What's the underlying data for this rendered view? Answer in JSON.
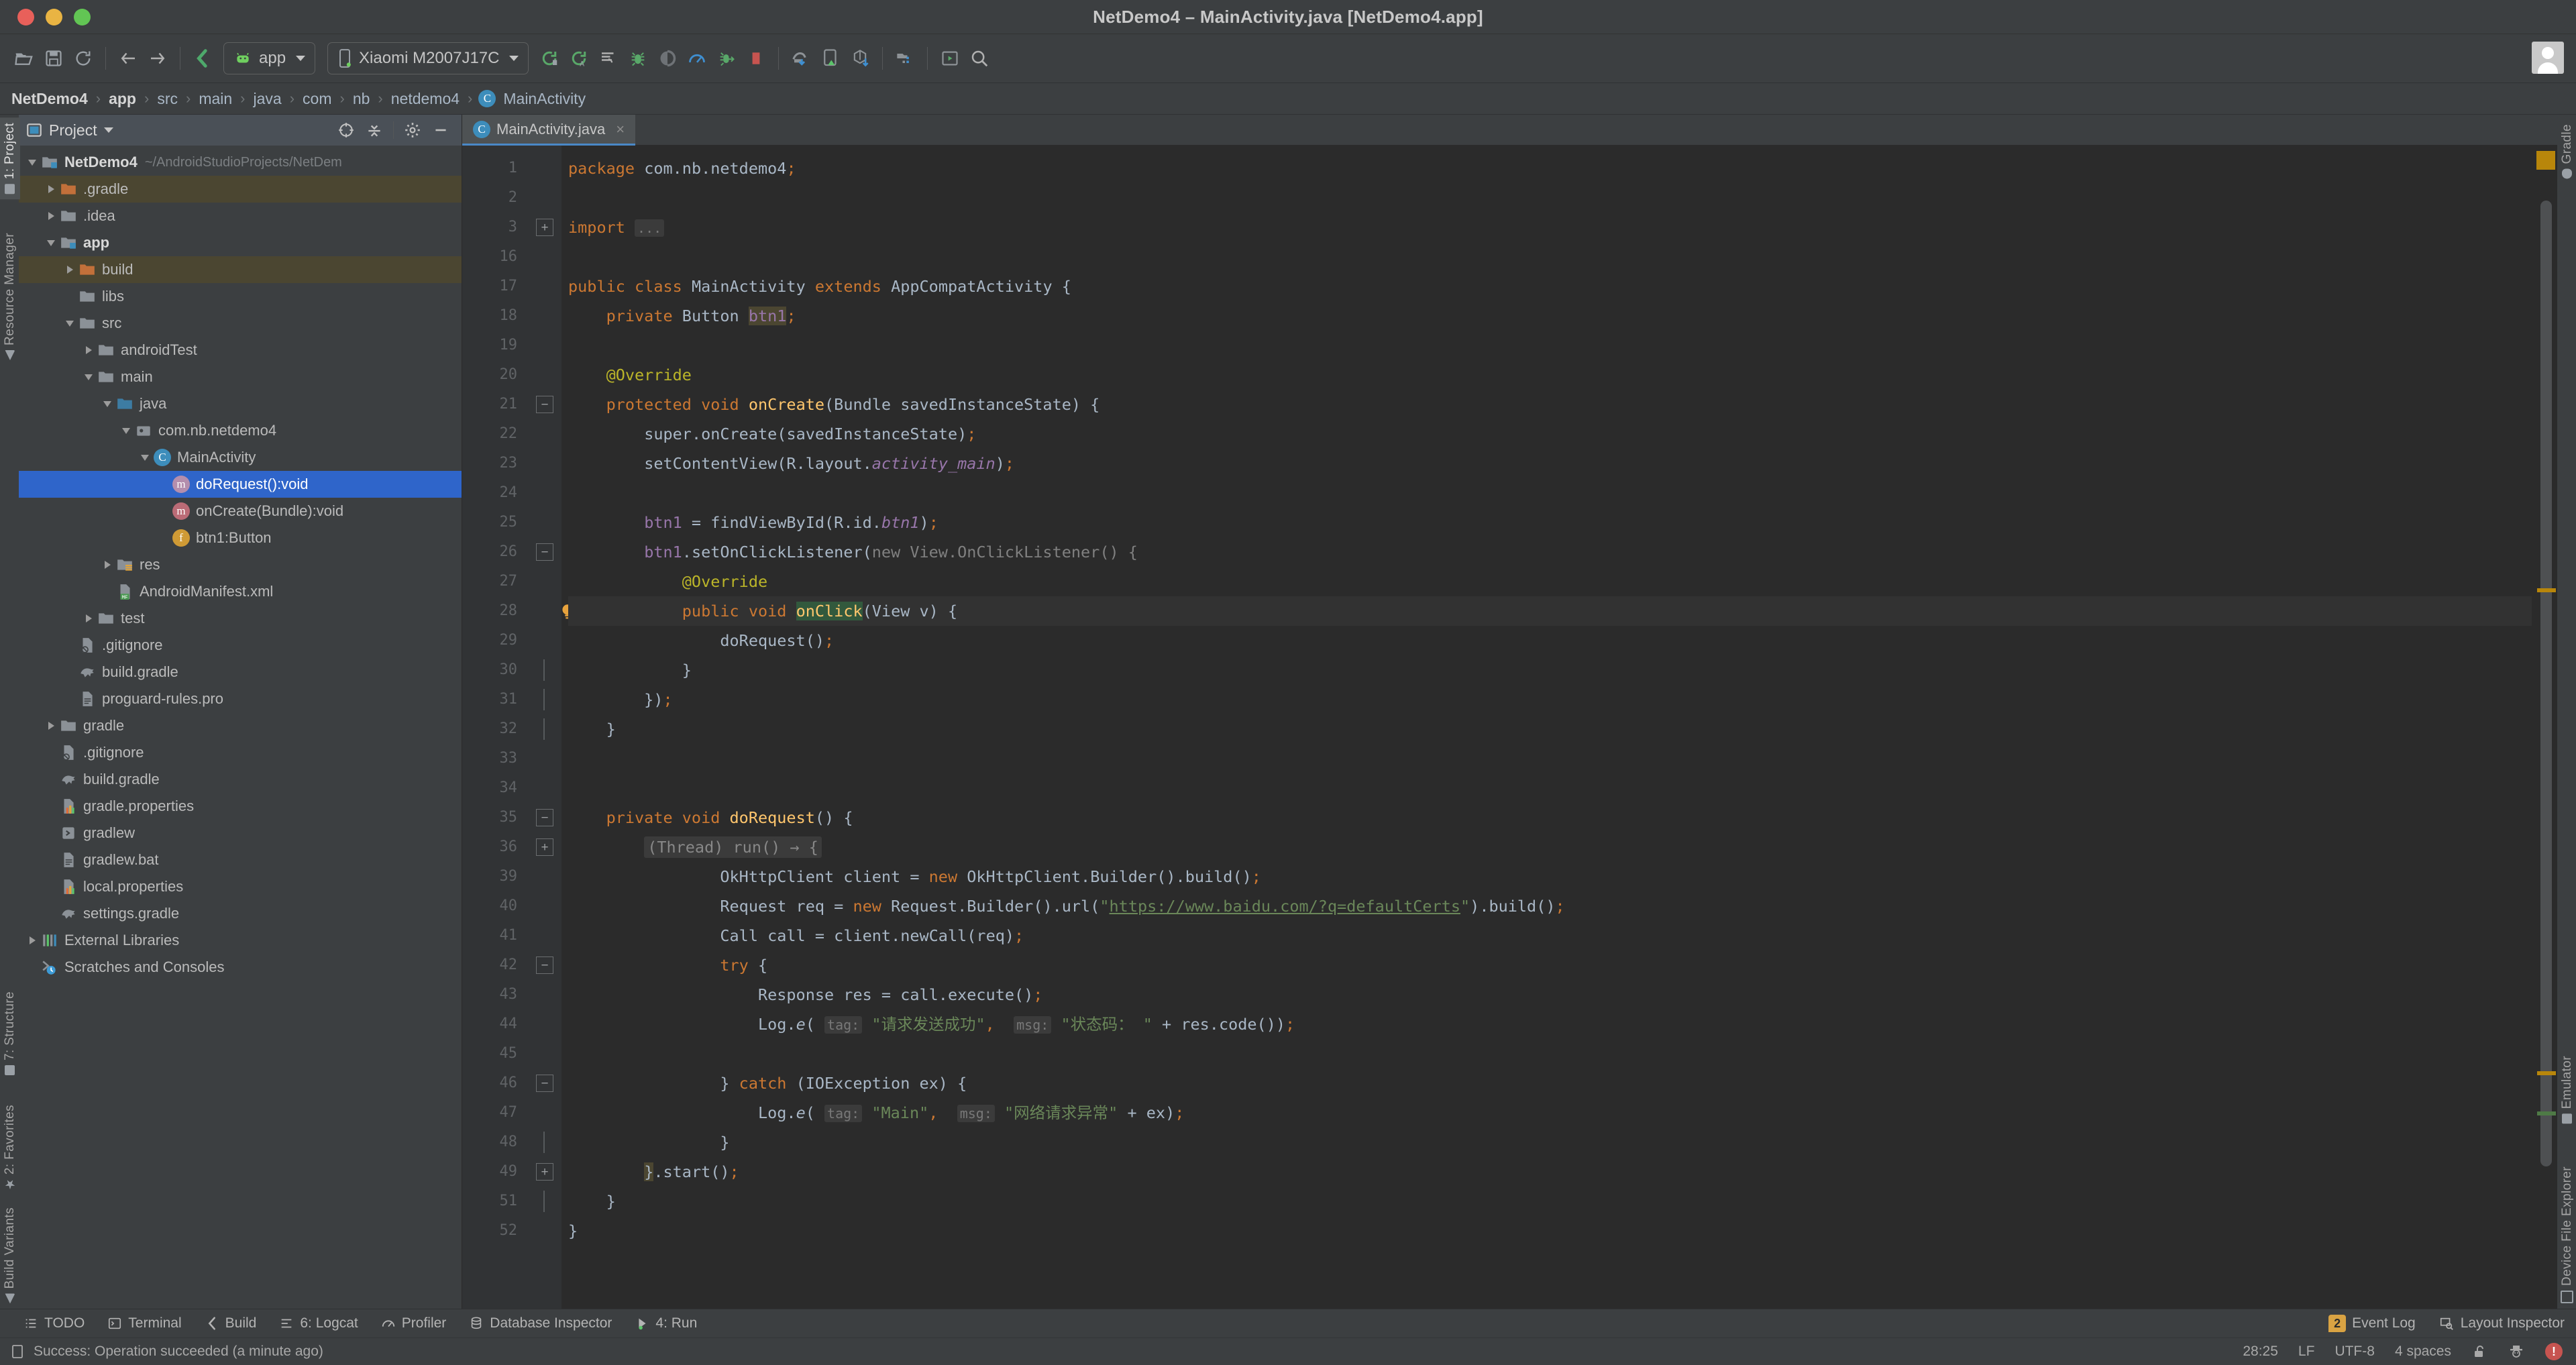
{
  "window": {
    "title": "NetDemo4 – MainActivity.java [NetDemo4.app]",
    "traffic": [
      "close",
      "minimize",
      "zoom"
    ]
  },
  "toolbar": {
    "buttons": [
      {
        "name": "open-folder-icon",
        "tip": "Open"
      },
      {
        "name": "save-all-icon",
        "tip": "Save All"
      },
      {
        "name": "sync-icon",
        "tip": "Sync Project with Gradle Files"
      },
      {
        "name": "back-arrow-icon",
        "tip": "Back"
      },
      {
        "name": "forward-arrow-icon",
        "tip": "Forward"
      },
      {
        "name": "avd-manager-icon",
        "tip": "AVD Manager"
      }
    ],
    "module_selector": {
      "label": "app",
      "icon": "android-icon"
    },
    "device_selector": {
      "label": "Xiaomi M2007J17C",
      "icon": "device-icon"
    },
    "run_buttons": [
      {
        "name": "run-icon",
        "tip": "Run 'app'"
      },
      {
        "name": "apply-changes-icon",
        "tip": "Apply Changes"
      },
      {
        "name": "apply-code-changes-icon",
        "tip": "Apply Code Changes"
      },
      {
        "name": "debug-icon",
        "tip": "Debug 'app'"
      },
      {
        "name": "run-coverage-icon",
        "tip": "Run with Coverage"
      },
      {
        "name": "profiler-icon",
        "tip": "Profile 'app'"
      },
      {
        "name": "attach-debugger-icon",
        "tip": "Attach Debugger to Android Process"
      },
      {
        "name": "stop-icon",
        "tip": "Stop"
      },
      {
        "name": "sdk-manager-icon",
        "tip": "SDK Manager"
      },
      {
        "name": "avd-manager2-icon",
        "tip": "Device Manager"
      },
      {
        "name": "profiler-arrow-icon",
        "tip": "Profiler"
      },
      {
        "name": "project-structure-icon",
        "tip": "Project Structure"
      },
      {
        "name": "layout-editor-icon",
        "tip": "Layout Editor"
      },
      {
        "name": "search-everywhere-icon",
        "tip": "Search Everywhere"
      }
    ]
  },
  "breadcrumb": {
    "items": [
      {
        "label": "NetDemo4",
        "bold": true
      },
      {
        "label": "app",
        "bold": true
      },
      {
        "label": "src",
        "bold": false
      },
      {
        "label": "main",
        "bold": false
      },
      {
        "label": "java",
        "bold": false
      },
      {
        "label": "com",
        "bold": false
      },
      {
        "label": "nb",
        "bold": false
      },
      {
        "label": "netdemo4",
        "bold": false
      },
      {
        "label": "MainActivity",
        "bold": false,
        "icon": "class-icon",
        "icon_letter": "C"
      }
    ],
    "separator": "›"
  },
  "left_tool_bar": {
    "items": [
      {
        "label": "1: Project",
        "active": true
      },
      {
        "label": "Resource Manager",
        "active": false
      }
    ],
    "bottom_items": [
      {
        "label": "7: Structure"
      },
      {
        "label": "2: Favorites"
      },
      {
        "label": "Build Variants"
      }
    ]
  },
  "right_tool_bar": {
    "top_items": [
      {
        "label": "Gradle"
      }
    ],
    "bottom_items": [
      {
        "label": "Emulator"
      },
      {
        "label": "Device File Explorer"
      }
    ]
  },
  "project_panel": {
    "title": "Project",
    "header_icons": [
      "locate-icon",
      "collapse-all-icon",
      "settings-gear-icon",
      "minimize-icon"
    ],
    "tree": [
      {
        "indent": 0,
        "arrow": "open",
        "icon": "module-icon",
        "label": "NetDemo4",
        "bold": true,
        "sub": "~/AndroidStudioProjects/NetDem",
        "style": ""
      },
      {
        "indent": 1,
        "arrow": "closed",
        "icon": "folder-orange",
        "label": ".gradle",
        "style": "olive"
      },
      {
        "indent": 1,
        "arrow": "closed",
        "icon": "folder-gray",
        "label": ".idea",
        "style": ""
      },
      {
        "indent": 1,
        "arrow": "open",
        "icon": "module-icon",
        "label": "app",
        "bold": true,
        "style": ""
      },
      {
        "indent": 2,
        "arrow": "closed",
        "icon": "folder-orange",
        "label": "build",
        "style": "olive"
      },
      {
        "indent": 2,
        "arrow": "none",
        "icon": "folder-gray",
        "label": "libs",
        "style": ""
      },
      {
        "indent": 2,
        "arrow": "open",
        "icon": "folder-gray",
        "label": "src",
        "style": ""
      },
      {
        "indent": 3,
        "arrow": "closed",
        "icon": "folder-gray",
        "label": "androidTest",
        "style": ""
      },
      {
        "indent": 3,
        "arrow": "open",
        "icon": "folder-gray",
        "label": "main",
        "style": ""
      },
      {
        "indent": 4,
        "arrow": "open",
        "icon": "folder-source",
        "label": "java",
        "style": ""
      },
      {
        "indent": 5,
        "arrow": "open",
        "icon": "package-icon",
        "label": "com.nb.netdemo4",
        "style": ""
      },
      {
        "indent": 6,
        "arrow": "open",
        "icon": "class-icon",
        "label": "MainActivity",
        "style": ""
      },
      {
        "indent": 7,
        "arrow": "none",
        "icon": "method-purple",
        "label": "doRequest():void",
        "style": "sel"
      },
      {
        "indent": 7,
        "arrow": "none",
        "icon": "method-red",
        "label": "onCreate(Bundle):void",
        "style": ""
      },
      {
        "indent": 7,
        "arrow": "none",
        "icon": "field-icon",
        "label": "btn1:Button",
        "style": ""
      },
      {
        "indent": 4,
        "arrow": "closed",
        "icon": "folder-res",
        "label": "res",
        "style": ""
      },
      {
        "indent": 4,
        "arrow": "none",
        "icon": "manifest-icon",
        "label": "AndroidManifest.xml",
        "style": ""
      },
      {
        "indent": 3,
        "arrow": "closed",
        "icon": "folder-gray",
        "label": "test",
        "style": ""
      },
      {
        "indent": 2,
        "arrow": "none",
        "icon": "gitignore-icon",
        "label": ".gitignore",
        "style": ""
      },
      {
        "indent": 2,
        "arrow": "none",
        "icon": "gradle-icon",
        "label": "build.gradle",
        "style": ""
      },
      {
        "indent": 2,
        "arrow": "none",
        "icon": "file-icon",
        "label": "proguard-rules.pro",
        "style": ""
      },
      {
        "indent": 1,
        "arrow": "closed",
        "icon": "folder-gray",
        "label": "gradle",
        "style": ""
      },
      {
        "indent": 1,
        "arrow": "none",
        "icon": "gitignore-icon",
        "label": ".gitignore",
        "style": ""
      },
      {
        "indent": 1,
        "arrow": "none",
        "icon": "gradle-icon",
        "label": "build.gradle",
        "style": ""
      },
      {
        "indent": 1,
        "arrow": "none",
        "icon": "properties-icon",
        "label": "gradle.properties",
        "style": ""
      },
      {
        "indent": 1,
        "arrow": "none",
        "icon": "script-icon",
        "label": "gradlew",
        "style": ""
      },
      {
        "indent": 1,
        "arrow": "none",
        "icon": "file-icon",
        "label": "gradlew.bat",
        "style": ""
      },
      {
        "indent": 1,
        "arrow": "none",
        "icon": "properties-icon",
        "label": "local.properties",
        "style": ""
      },
      {
        "indent": 1,
        "arrow": "none",
        "icon": "gradle-icon",
        "label": "settings.gradle",
        "style": ""
      },
      {
        "indent": 0,
        "arrow": "closed",
        "icon": "libraries-icon",
        "label": "External Libraries",
        "style": ""
      },
      {
        "indent": 0,
        "arrow": "none",
        "icon": "scratches-icon",
        "label": "Scratches and Consoles",
        "style": ""
      }
    ]
  },
  "editor": {
    "tab": {
      "label": "MainActivity.java",
      "icon": "class-icon",
      "icon_letter": "C",
      "close": "×"
    },
    "line_numbers": [
      1,
      2,
      3,
      16,
      17,
      18,
      19,
      20,
      21,
      22,
      23,
      24,
      25,
      26,
      27,
      28,
      29,
      30,
      31,
      32,
      33,
      34,
      35,
      36,
      39,
      40,
      41,
      42,
      43,
      44,
      45,
      46,
      47,
      48,
      49,
      51,
      52
    ],
    "code_lines": [
      {
        "n": 1,
        "html": "<span class='kw'>package</span> <span class='pln'>com.nb.netdemo4</span><span class='kw'>;</span>"
      },
      {
        "n": 2,
        "html": ""
      },
      {
        "n": 3,
        "html": "<span class='kw'>import</span> <span class='hint'>...</span>"
      },
      {
        "n": 16,
        "html": ""
      },
      {
        "n": 17,
        "html": "<span class='kw'>public class</span> <span class='pln'>MainActivity</span> <span class='kw'>extends</span> <span class='pln'>AppCompatActivity</span> {"
      },
      {
        "n": 18,
        "html": "    <span class='kw'>private</span> <span class='pln'>Button</span> <span class='fld hl-ident'>btn1</span><span class='kw'>;</span>"
      },
      {
        "n": 19,
        "html": ""
      },
      {
        "n": 20,
        "html": "    <span class='ann'>@Override</span>"
      },
      {
        "n": 21,
        "html": "    <span class='kw'>protected void</span> <span class='fn'>onCreate</span>(<span class='pln'>Bundle savedInstanceState</span>) {"
      },
      {
        "n": 22,
        "html": "        <span class='pln'>super</span>.<span class='pln'>onCreate</span>(<span class='pln'>savedInstanceState</span>)<span class='kw'>;</span>"
      },
      {
        "n": 23,
        "html": "        <span class='pln'>setContentView</span>(<span class='pln'>R</span>.<span class='pln'>layout</span>.<span class='sfld'>activity_main</span>)<span class='kw'>;</span>"
      },
      {
        "n": 24,
        "html": ""
      },
      {
        "n": 25,
        "html": "        <span class='fld'>btn1</span> = <span class='pln'>findViewById</span>(<span class='pln'>R</span>.<span class='pln'>id</span>.<span class='sfld'>btn1</span>)<span class='kw'>;</span>"
      },
      {
        "n": 26,
        "html": "        <span class='fld'>btn1</span>.<span class='pln'>setOnClickListener</span>(<span class='gray'>new View.OnClickListener() {</span>"
      },
      {
        "n": 27,
        "html": "            <span class='ann'>@Override</span>"
      },
      {
        "n": 28,
        "html": "            <span class='kw'>public void</span> <span class='fn hl-onclick'>onClick</span>(<span class='pln'>View v</span>) {",
        "hl": true
      },
      {
        "n": 29,
        "html": "                <span class='pln'>doRequest</span>()<span class='kw'>;</span>"
      },
      {
        "n": 30,
        "html": "            }"
      },
      {
        "n": 31,
        "html": "        })<span class='kw'>;</span>"
      },
      {
        "n": 32,
        "html": "    }"
      },
      {
        "n": 33,
        "html": ""
      },
      {
        "n": 34,
        "html": ""
      },
      {
        "n": 35,
        "html": "    <span class='kw'>private void</span> <span class='fn'>doRequest</span>() {"
      },
      {
        "n": 36,
        "html": "        <span class='lambda'>(Thread) run() → {</span>"
      },
      {
        "n": 39,
        "html": "                <span class='pln'>OkHttpClient client</span> = <span class='kw'>new</span> <span class='pln'>OkHttpClient.Builder</span>().<span class='pln'>build</span>()<span class='kw'>;</span>"
      },
      {
        "n": 40,
        "html": "                <span class='pln'>Request req</span> = <span class='kw'>new</span> <span class='pln'>Request.Builder</span>().<span class='pln'>url</span>(<span class='str'>\"</span><span class='url'>https://www.baidu.com/?q=defaultCerts</span><span class='str'>\"</span>).<span class='pln'>build</span>()<span class='kw'>;</span>"
      },
      {
        "n": 41,
        "html": "                <span class='pln'>Call call</span> = <span class='pln'>client</span>.<span class='pln'>newCall</span>(<span class='pln'>req</span>)<span class='kw'>;</span>"
      },
      {
        "n": 42,
        "html": "                <span class='kw'>try</span> {"
      },
      {
        "n": 43,
        "html": "                    <span class='pln'>Response res</span> = <span class='pln'>call</span>.<span class='pln'>execute</span>()<span class='kw'>;</span>"
      },
      {
        "n": 44,
        "html": "                    <span class='pln'>Log</span>.<span class='pln' style='font-style:italic'>e</span>( <span class='hint'>tag:</span> <span class='str'>\"请求发送成功\"</span><span class='kw'>,</span>  <span class='hint'>msg:</span> <span class='str'>\"状态码： \"</span> + <span class='pln'>res</span>.<span class='pln'>code</span>())<span class='kw'>;</span>"
      },
      {
        "n": 45,
        "html": ""
      },
      {
        "n": 46,
        "html": "                } <span class='kw'>catch</span> (<span class='pln'>IOException ex</span>) {"
      },
      {
        "n": 47,
        "html": "                    <span class='pln'>Log</span>.<span class='pln' style='font-style:italic'>e</span>( <span class='hint'>tag:</span> <span class='str'>\"Main\"</span><span class='kw'>,</span>  <span class='hint'>msg:</span> <span class='str'>\"网络请求异常\"</span> + <span class='pln'>ex</span>)<span class='kw'>;</span>"
      },
      {
        "n": 48,
        "html": "                }"
      },
      {
        "n": 49,
        "html": "        <span class='hl-ident'>}</span>.<span class='pln'>start</span>()<span class='kw'>;</span>"
      },
      {
        "n": 51,
        "html": "    }"
      },
      {
        "n": 52,
        "html": "}"
      }
    ],
    "gutter_marks": [
      {
        "line": 17,
        "icon": "class-gutter-icon"
      },
      {
        "line": 21,
        "icon": "override-method-icon"
      },
      {
        "line": 28,
        "icon": "override-method-icon"
      },
      {
        "line": 28,
        "icon": "intention-bulb-icon"
      },
      {
        "line": 36,
        "icon": "override-method-icon"
      }
    ]
  },
  "bottom_tool_bar": {
    "items": [
      {
        "label": "TODO",
        "icon": "todo-icon",
        "mnemonic": ""
      },
      {
        "label": "Terminal",
        "icon": "terminal-icon",
        "mnemonic": ""
      },
      {
        "label": "Build",
        "icon": "build-icon",
        "mnemonic": ""
      },
      {
        "label": "6: Logcat",
        "icon": "logcat-icon",
        "mnemonic": "6"
      },
      {
        "label": "Profiler",
        "icon": "profiler-icon",
        "mnemonic": ""
      },
      {
        "label": "Database Inspector",
        "icon": "database-icon",
        "mnemonic": ""
      },
      {
        "label": "4: Run",
        "icon": "run-green-icon",
        "mnemonic": "4"
      }
    ],
    "right_items": [
      {
        "label": "Event Log",
        "badge": "2",
        "icon": "event-log-badge"
      },
      {
        "label": "Layout Inspector",
        "icon": "layout-inspector-icon"
      }
    ]
  },
  "status_bar": {
    "message": "Success: Operation succeeded (a minute ago)",
    "message_icon": "build-status-icon",
    "caret_position": "28:25",
    "line_separator": "LF",
    "encoding": "UTF-8",
    "indent": "4 spaces",
    "icons": [
      "unlock-icon",
      "inspector-hat-icon",
      "error-badge-icon"
    ]
  },
  "colors": {
    "panel_bg": "#3c3f41",
    "editor_bg": "#2b2b2b",
    "gutter_bg": "#313335",
    "selection_blue": "#2f65ca",
    "accent_blue": "#4a88c7",
    "keyword_orange": "#cc7832",
    "string_green": "#6a8759",
    "field_purple": "#9876aa",
    "method_yellow": "#ffc66d",
    "annotation_olive": "#bbb529",
    "marker_gold": "#b8860b",
    "error_red": "#c75450"
  }
}
